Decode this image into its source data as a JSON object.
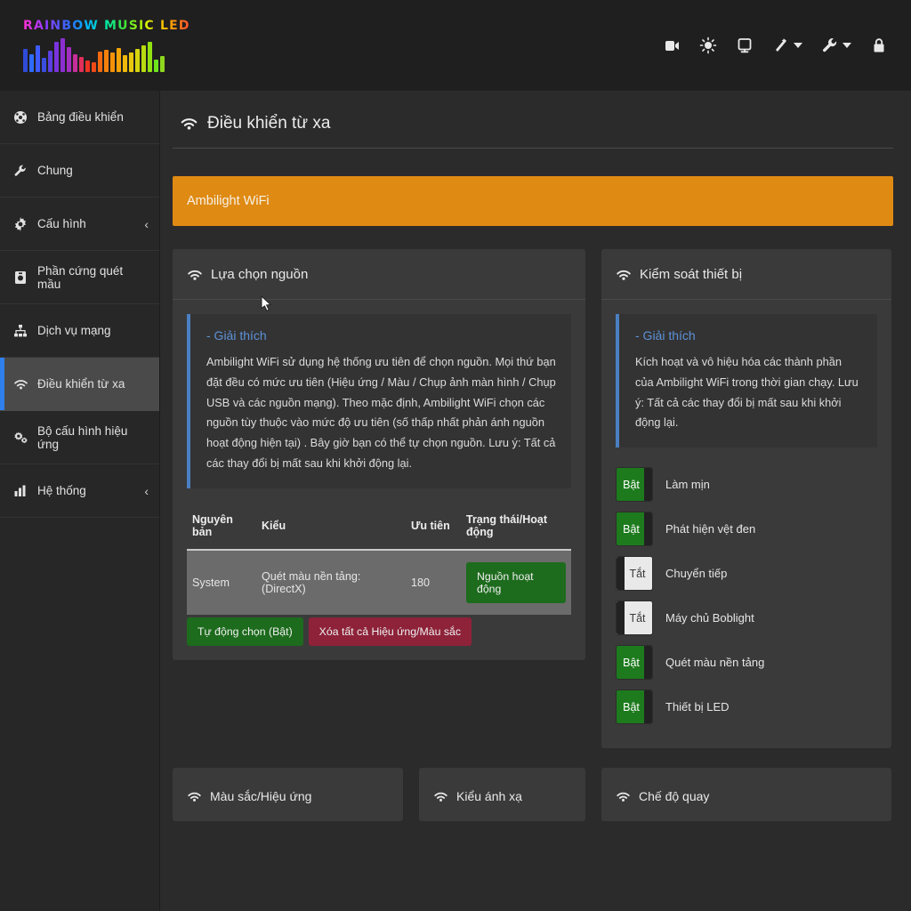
{
  "brand": {
    "name": "RAINBOW MUSIC LED",
    "logo_icon": "equalizer-bars"
  },
  "topbar": {
    "icons": [
      {
        "name": "video-icon",
        "label": "Video"
      },
      {
        "name": "brightness-icon",
        "label": "Brightness"
      },
      {
        "name": "monitor-icon",
        "label": "Monitor"
      },
      {
        "name": "magic-wand-icon",
        "label": "Effects",
        "has_caret": true
      },
      {
        "name": "wrench-icon",
        "label": "Tools",
        "has_caret": true
      },
      {
        "name": "lock-icon",
        "label": "Lock"
      }
    ]
  },
  "sidebar": {
    "items": [
      {
        "label": "Bảng điều khiển",
        "icon": "dashboard-icon",
        "active": false,
        "chevron": ""
      },
      {
        "label": "Chung",
        "icon": "wrench-icon",
        "active": false,
        "chevron": ""
      },
      {
        "label": "Cấu hình",
        "icon": "gear-icon",
        "active": false,
        "chevron": "‹"
      },
      {
        "label": "Phần cứng quét mầu",
        "icon": "camera-icon",
        "active": false,
        "chevron": ""
      },
      {
        "label": "Dịch vụ mạng",
        "icon": "network-icon",
        "active": false,
        "chevron": ""
      },
      {
        "label": "Điều khiển từ xa",
        "icon": "wifi-icon",
        "active": true,
        "chevron": ""
      },
      {
        "label": "Bộ cấu hình hiệu ứng",
        "icon": "gears-icon",
        "active": false,
        "chevron": ""
      },
      {
        "label": "Hệ thống",
        "icon": "chart-icon",
        "active": false,
        "chevron": "‹"
      }
    ]
  },
  "page": {
    "title": "Điều khiển từ xa",
    "title_icon": "wifi-icon",
    "alert": "Ambilight WiFi",
    "alert_color": "#df8a13"
  },
  "source_card": {
    "title": "Lựa chọn nguồn",
    "icon": "wifi-icon",
    "explain_title": "- Giải thích",
    "explain_text": "Ambilight WiFi sử dụng hệ thống ưu tiên để chọn nguồn. Mọi thứ bạn đặt đều có mức ưu tiên (Hiệu ứng / Màu / Chụp ảnh màn hình / Chụp USB và các nguồn mạng). Theo mặc định, Ambilight WiFi chọn các nguồn tùy thuộc vào mức độ ưu tiên (số thấp nhất phản ánh nguồn hoạt động hiện tại) . Bây giờ bạn có thể tự chọn nguồn. Lưu ý: Tất cả các thay đổi bị mất sau khi khởi động lại.",
    "table": {
      "headers": [
        "Nguyên bản",
        "Kiểu",
        "Ưu tiên",
        "Trạng thái/Hoạt động"
      ],
      "rows": [
        {
          "origin": "System",
          "type": "Quét màu nền tảng: (DirectX)",
          "priority": "180",
          "status": "Nguồn hoạt động"
        }
      ]
    },
    "buttons": [
      {
        "label": "Tự động chọn (Bật)",
        "color": "#1d6b1d",
        "name": "auto-select-button"
      },
      {
        "label": "Xóa tất cả Hiệu ứng/Màu sắc",
        "color": "#8d2239",
        "name": "clear-all-button"
      }
    ]
  },
  "device_card": {
    "title": "Kiểm soát thiết bị",
    "icon": "wifi-icon",
    "explain_title": "- Giải thích",
    "explain_text": "Kích hoạt và vô hiệu hóa các thành phần của Ambilight WiFi trong thời gian chạy. Lưu ý: Tất cả các thay đổi bị mất sau khi khởi động lại.",
    "toggles": [
      {
        "label": "Làm mịn",
        "state": "Bật",
        "on": true
      },
      {
        "label": "Phát hiện vệt đen",
        "state": "Bật",
        "on": true
      },
      {
        "label": "Chuyển tiếp",
        "state": "Tắt",
        "on": false
      },
      {
        "label": "Máy chủ Boblight",
        "state": "Tắt",
        "on": false
      },
      {
        "label": "Quét màu nền tảng",
        "state": "Bật",
        "on": true
      },
      {
        "label": "Thiết bị LED",
        "state": "Bật",
        "on": true
      }
    ]
  },
  "bottom_cards": [
    {
      "title": "Màu sắc/Hiệu ứng",
      "icon": "wifi-icon"
    },
    {
      "title": "Kiểu ánh xạ",
      "icon": "wifi-icon"
    },
    {
      "title": "Chế độ quay",
      "icon": "wifi-icon"
    }
  ],
  "colors": {
    "page_bg": "#2b2b2b",
    "card_bg": "#3a3a3a",
    "topbar_bg": "#1f1f1f",
    "sidebar_bg": "#272727",
    "accent_blue": "#2f80ed",
    "alert_orange": "#df8a13",
    "green": "#1d6b1d",
    "red": "#8d2239",
    "row_gray": "#6b6b6b"
  }
}
